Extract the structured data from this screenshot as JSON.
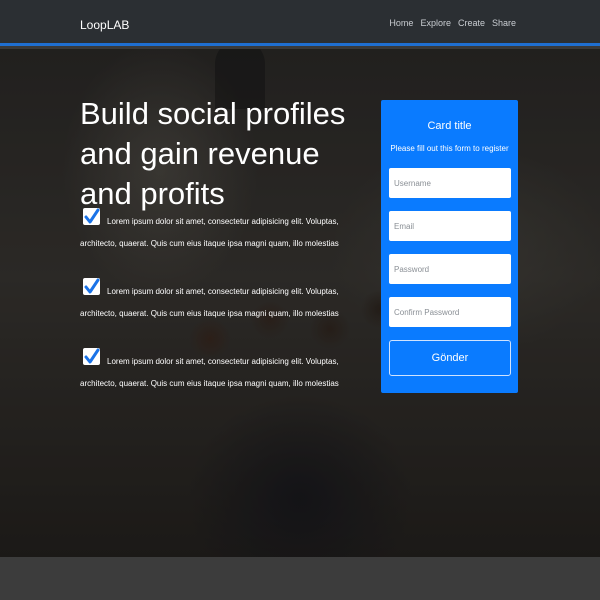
{
  "navbar": {
    "brand": "LoopLAB",
    "links": [
      "Home",
      "Explore",
      "Create",
      "Share"
    ]
  },
  "hero": {
    "headline": "Build social profiles and gain revenue and profits",
    "features": [
      "Lorem ipsum dolor sit amet, consectetur adipisicing elit. Voluptas, architecto, quaerat. Quis cum eius itaque ipsa magni quam, illo molestias",
      "Lorem ipsum dolor sit amet, consectetur adipisicing elit. Voluptas, architecto, quaerat. Quis cum eius itaque ipsa magni quam, illo molestias",
      "Lorem ipsum dolor sit amet, consectetur adipisicing elit. Voluptas, architecto, quaerat. Quis cum eius itaque ipsa magni quam, illo molestias"
    ],
    "check_icon": "checkbox-checked-icon"
  },
  "card": {
    "title": "Card title",
    "subtitle": "Please fill out this form to register",
    "fields": {
      "username": {
        "placeholder": "Username",
        "value": ""
      },
      "email": {
        "placeholder": "Email",
        "value": ""
      },
      "password": {
        "placeholder": "Password",
        "value": ""
      },
      "confirm_password": {
        "placeholder": "Confirm Password",
        "value": ""
      }
    },
    "submit_label": "Gönder"
  },
  "colors": {
    "navbar_bg": "#2b2f33",
    "navbar_border": "#1f6fd1",
    "card_bg": "#0a7bff",
    "check_blue": "#1a73e8"
  }
}
